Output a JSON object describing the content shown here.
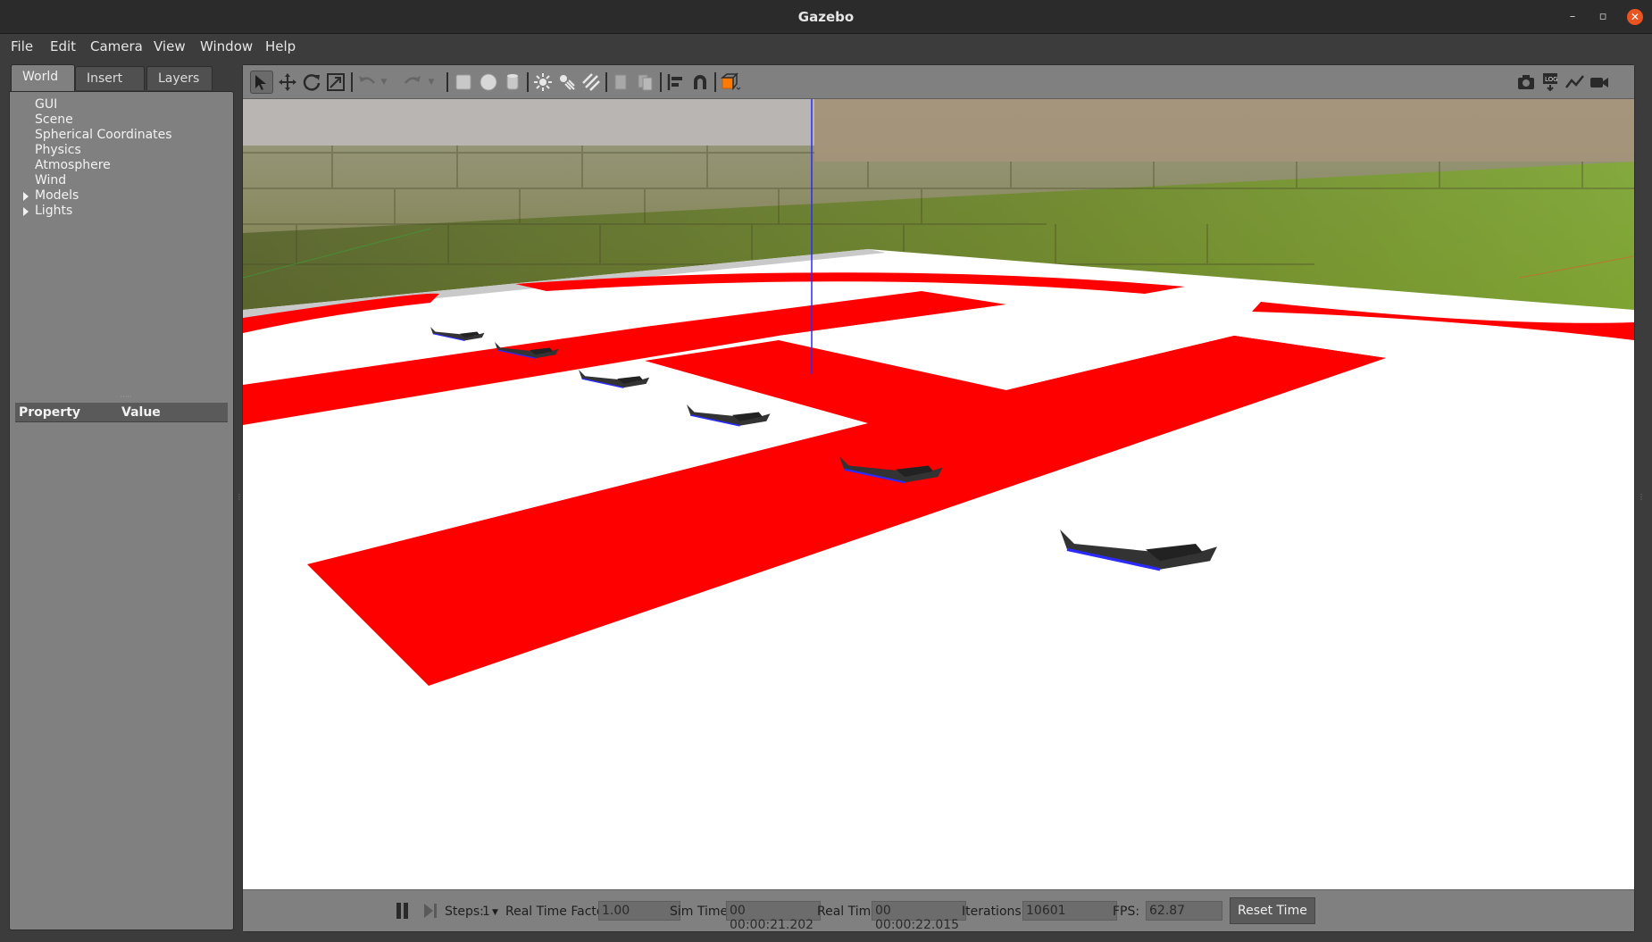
{
  "window": {
    "title": "Gazebo"
  },
  "menubar": [
    "File",
    "Edit",
    "Camera",
    "View",
    "Window",
    "Help"
  ],
  "left_panel": {
    "tabs": [
      "World",
      "Insert",
      "Layers"
    ],
    "active_tab": "World",
    "tree": [
      "GUI",
      "Scene",
      "Spherical Coordinates",
      "Physics",
      "Atmosphere",
      "Wind",
      "Models",
      "Lights"
    ],
    "expandable": [
      "Models",
      "Lights"
    ],
    "property_header": {
      "property": "Property",
      "value": "Value"
    }
  },
  "toolbar": {
    "tools": [
      "select-mode",
      "translate-mode",
      "rotate-mode",
      "scale-mode",
      "undo",
      "redo",
      "box-shape",
      "sphere-shape",
      "cylinder-shape",
      "point-light",
      "spot-light",
      "directional-light",
      "copy",
      "paste",
      "align",
      "snap",
      "view-angle"
    ],
    "right_tools": [
      "screenshot",
      "log",
      "plot",
      "video-record"
    ]
  },
  "bottom_bar": {
    "steps_label": "Steps:",
    "steps_value": "1",
    "rtf_label": "Real Time Factor:",
    "rtf_value": "1.00",
    "sim_time_label": "Sim Time:",
    "sim_time_value": "00 00:00:21.202",
    "real_time_label": "Real Time:",
    "real_time_value": "00 00:00:22.015",
    "iterations_label": "Iterations:",
    "iterations_value": "10601",
    "fps_label": "FPS:",
    "fps_value": "62.87",
    "reset_label": "Reset Time"
  },
  "colors": {
    "accent_close": "#e95420",
    "helipad_red": "#ff0000",
    "ground_white": "#ffffff",
    "grass_green": "#6e9a25",
    "wall_brick": "#8a8a55"
  }
}
